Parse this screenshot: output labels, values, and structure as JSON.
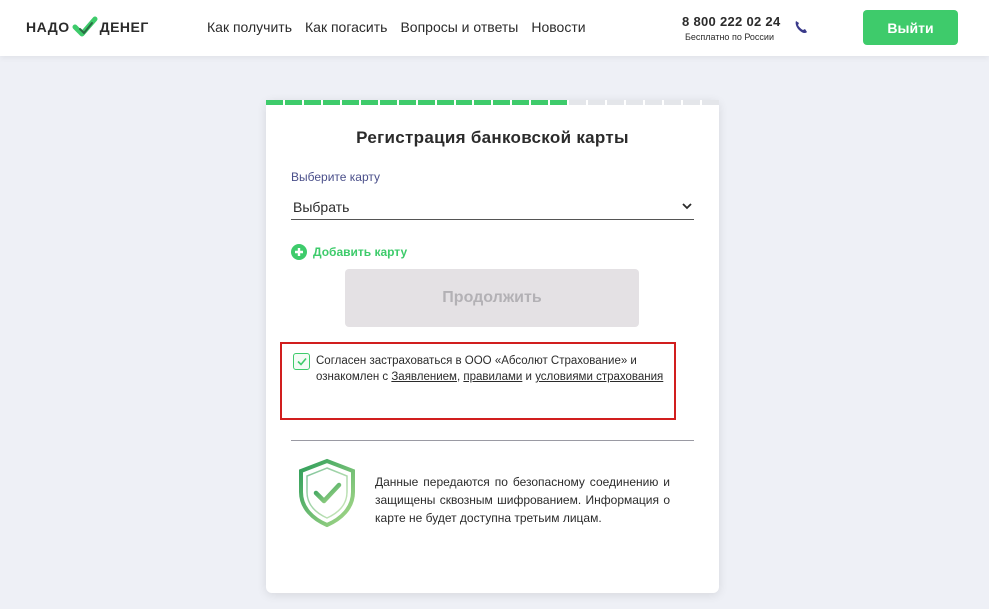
{
  "header": {
    "logo": {
      "left": "НАДО",
      "right": "ДЕНЕГ",
      "mark_icon": "check-logo-icon"
    },
    "nav": [
      {
        "label": "Как получить"
      },
      {
        "label": "Как погасить"
      },
      {
        "label": "Вопросы и ответы"
      },
      {
        "label": "Новости"
      }
    ],
    "phone": {
      "number": "8 800 222 02 24",
      "subtitle": "Бесплатно по России",
      "icon": "phone-icon"
    },
    "logout_label": "Выйти"
  },
  "card": {
    "progress": {
      "segments_total": 24,
      "segments_done": 16
    },
    "title": "Регистрация банковской карты",
    "select": {
      "label": "Выберите карту",
      "value": "Выбрать"
    },
    "add_card_label": "Добавить карту",
    "continue_label": "Продолжить",
    "consent": {
      "checked": true,
      "text_before": "Согласен застраховаться в ООО «Абсолют Страхование» и ознакомлен с ",
      "link_statement": "Заявлением",
      "sep1": ", ",
      "link_rules": "правилами",
      "sep2": " и ",
      "link_conditions": "условиями страхования"
    },
    "security_text": "Данные передаются по безопасному соединению и защищены сквозным шифрованием. Информация о карте не будет доступна третьим лицам."
  },
  "colors": {
    "accent": "#3ecb6b",
    "highlight_border": "#d11e1e",
    "background": "#eef0f6",
    "disabled_button": "#e4e1e4"
  }
}
